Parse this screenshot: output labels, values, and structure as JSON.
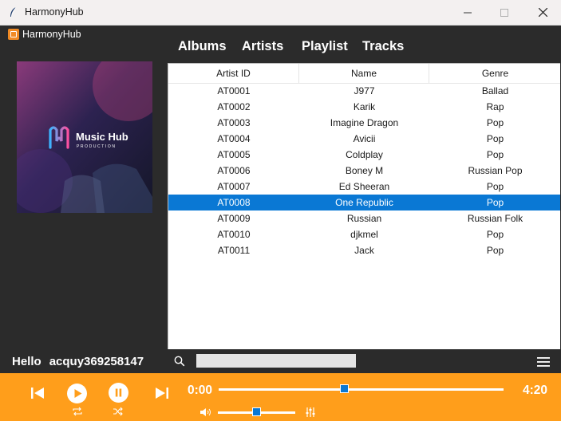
{
  "window": {
    "title": "HarmonyHub"
  },
  "sidebar": {
    "app_label": "HarmonyHub",
    "album_art": {
      "text_main": "Music Hub",
      "text_sub": "PRODUCTION"
    }
  },
  "tabs": [
    {
      "label": "Albums"
    },
    {
      "label": "Artists"
    },
    {
      "label": "Playlist"
    },
    {
      "label": "Tracks"
    }
  ],
  "table": {
    "columns": [
      "Artist ID",
      "Name",
      "Genre"
    ],
    "rows": [
      [
        "AT0001",
        "J977",
        "Ballad"
      ],
      [
        "AT0002",
        "Karik",
        "Rap"
      ],
      [
        "AT0003",
        "Imagine Dragon",
        "Pop"
      ],
      [
        "AT0004",
        "Avicii",
        "Pop"
      ],
      [
        "AT0005",
        "Coldplay",
        "Pop"
      ],
      [
        "AT0006",
        "Boney M",
        "Russian Pop"
      ],
      [
        "AT0007",
        "Ed Sheeran",
        "Pop"
      ],
      [
        "AT0008",
        "One Republic",
        "Pop"
      ],
      [
        "AT0009",
        "Russian",
        "Russian Folk"
      ],
      [
        "AT0010",
        "djkmel",
        "Pop"
      ],
      [
        "AT0011",
        "Jack",
        "Pop"
      ]
    ],
    "selected_index": 7
  },
  "greeting": {
    "hello": "Hello",
    "username": "acquy369258147"
  },
  "search": {
    "placeholder": "",
    "value": ""
  },
  "player": {
    "current_time": "0:00",
    "total_time": "4:20",
    "progress_fraction": 0.44,
    "volume_fraction": 0.5,
    "accent_color": "#ff9e1b",
    "thumb_color": "#0a78d4"
  },
  "icons": {
    "app": "feather-icon",
    "minimize": "minimize-icon",
    "maximize": "maximize-icon",
    "close": "close-icon",
    "previous": "skip-previous-icon",
    "play": "play-icon",
    "pause": "pause-icon",
    "next": "skip-next-icon",
    "repeat": "repeat-icon",
    "shuffle": "shuffle-icon",
    "volume": "volume-icon",
    "equalizer": "equalizer-icon",
    "search": "search-icon",
    "menu": "hamburger-menu-icon"
  }
}
